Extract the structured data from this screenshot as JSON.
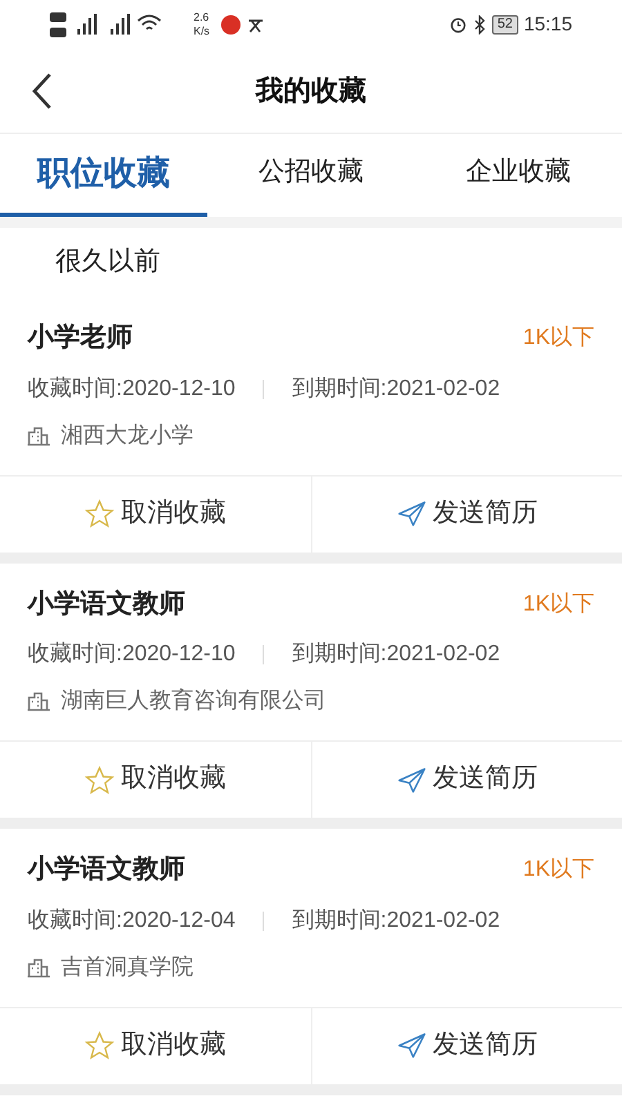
{
  "status_bar": {
    "speed_value": "2.6",
    "speed_unit": "K/s",
    "battery": "52",
    "time": "15:15"
  },
  "header": {
    "title": "我的收藏"
  },
  "tabs": [
    {
      "label": "职位收藏",
      "selected": true
    },
    {
      "label": "公招收藏",
      "selected": false
    },
    {
      "label": "企业收藏",
      "selected": false
    }
  ],
  "section_label": "很久以前",
  "jobs": [
    {
      "title": "小学老师",
      "salary": "1K以下",
      "saved_time": "收藏时间:2020-12-10",
      "expire_time": "到期时间:2021-02-02",
      "company": "湘西大龙小学",
      "actions": [
        "取消收藏",
        "发送简历"
      ]
    },
    {
      "title": "小学语文教师",
      "salary": "1K以下",
      "saved_time": "收藏时间:2020-12-10",
      "expire_time": "到期时间:2021-02-02",
      "company": "湖南巨人教育咨询有限公司",
      "actions": [
        "取消收藏",
        "发送简历"
      ]
    },
    {
      "title": "小学语文教师",
      "salary": "1K以下",
      "saved_time": "收藏时间:2020-12-04",
      "expire_time": "到期时间:2021-02-02",
      "company": "吉首洞真学院",
      "actions": [
        "取消收藏",
        "发送简历"
      ]
    }
  ]
}
